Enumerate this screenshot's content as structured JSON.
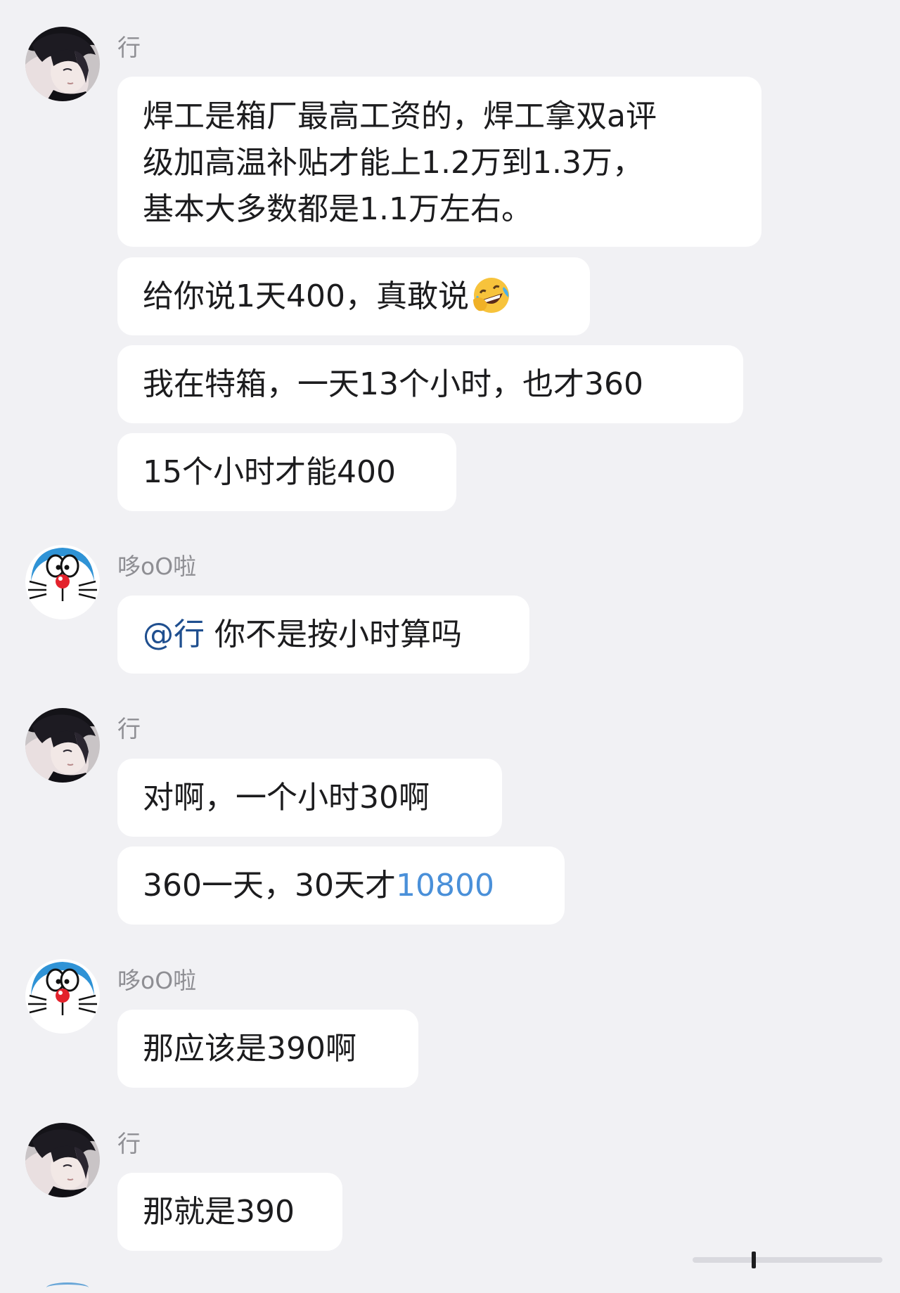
{
  "messages": [
    {
      "sender": "行",
      "avatar_icon": "anime-boy-avatar-icon",
      "bubbles": [
        {
          "lines": [
            "焊工是箱厂最高工资的，焊工拿双a评",
            "级加高温补贴才能上1.2万到1.3万，",
            "基本大多数都是1.1万左右。"
          ]
        },
        {
          "text": "给你说1天400，真敢说",
          "emoji": "rofl-emoji-icon"
        },
        {
          "text": "我在特箱，一天13个小时，也才360"
        },
        {
          "text": "15个小时才能400"
        }
      ]
    },
    {
      "sender": "哆oO啦",
      "avatar_icon": "doraemon-avatar-icon",
      "bubbles": [
        {
          "mention": "@行",
          "text": " 你不是按小时算吗"
        }
      ]
    },
    {
      "sender": "行",
      "avatar_icon": "anime-boy-avatar-icon",
      "bubbles": [
        {
          "text": "对啊，一个小时30啊"
        },
        {
          "text": "360一天，30天才",
          "link_number": "10800"
        }
      ]
    },
    {
      "sender": "哆oO啦",
      "avatar_icon": "doraemon-avatar-icon",
      "bubbles": [
        {
          "text": "那应该是390啊"
        }
      ]
    },
    {
      "sender": "行",
      "avatar_icon": "anime-boy-avatar-icon",
      "bubbles": [
        {
          "text": "那就是390"
        }
      ]
    }
  ],
  "colors": {
    "background": "#f1f1f4",
    "bubble": "#ffffff",
    "mention": "#1f4f8f",
    "link_number": "#4a90d9",
    "sender_name": "#8e8e93"
  }
}
